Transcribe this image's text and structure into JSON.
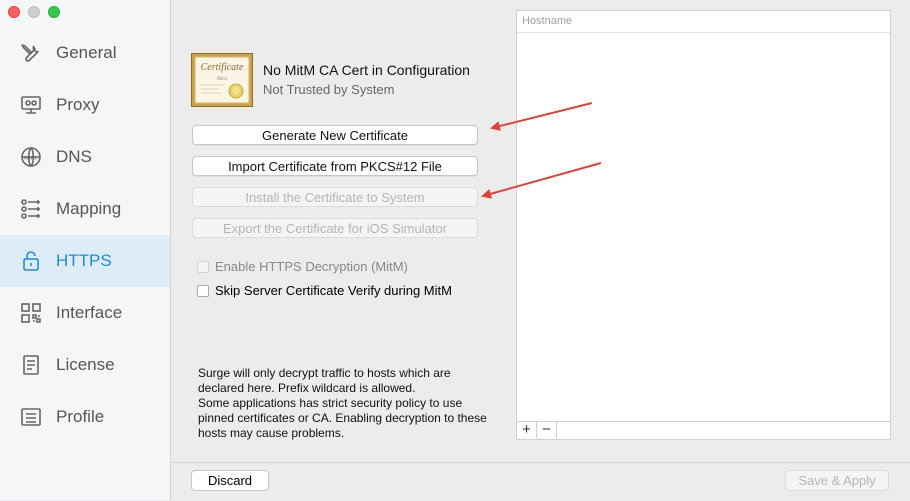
{
  "sidebar": {
    "items": [
      {
        "label": "General",
        "icon": "tools-icon",
        "active": false
      },
      {
        "label": "Proxy",
        "icon": "proxy-icon",
        "active": false
      },
      {
        "label": "DNS",
        "icon": "globe-icon",
        "active": false
      },
      {
        "label": "Mapping",
        "icon": "mapping-icon",
        "active": false
      },
      {
        "label": "HTTPS",
        "icon": "lock-icon",
        "active": true
      },
      {
        "label": "Interface",
        "icon": "qrcode-icon",
        "active": false
      },
      {
        "label": "License",
        "icon": "document-icon",
        "active": false
      },
      {
        "label": "Profile",
        "icon": "list-icon",
        "active": false
      }
    ],
    "active_color": "#1a8fd8"
  },
  "certificate": {
    "title": "No MitM CA Cert in Configuration",
    "subtitle": "Not Trusted by System",
    "image_text": "Certificate",
    "image_subtext": "Best"
  },
  "buttons": {
    "generate": "Generate New Certificate",
    "import": "Import Certificate from PKCS#12 File",
    "install": "Install the Certificate to System",
    "export": "Export the Certificate for iOS Simulator"
  },
  "checkboxes": {
    "enable_https": "Enable HTTPS Decryption (MitM)",
    "skip_verify": "Skip Server Certificate Verify during MitM"
  },
  "info_text": "Surge will only decrypt traffic to hosts which are\ndeclared here. Prefix wildcard is allowed.\nSome applications has strict security policy to use\npinned certificates or CA. Enabling decryption to these\nhosts may cause problems.",
  "hostname_table": {
    "header": "Hostname",
    "add": "+",
    "remove": "−"
  },
  "footer": {
    "discard": "Discard",
    "save": "Save & Apply"
  },
  "annotation_color": "#e0413a"
}
